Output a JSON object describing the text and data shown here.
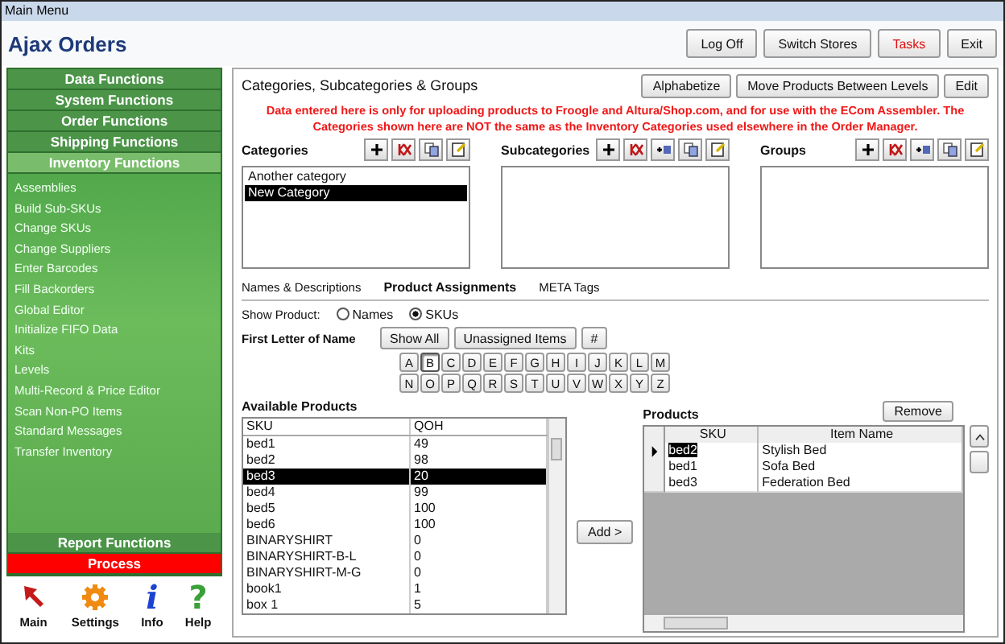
{
  "window": {
    "title": "Main Menu"
  },
  "app_title": "Ajax Orders",
  "header_buttons": [
    {
      "label": "Log Off",
      "kind": "normal"
    },
    {
      "label": "Switch Stores",
      "kind": "normal"
    },
    {
      "label": "Tasks",
      "kind": "alert"
    },
    {
      "label": "Exit",
      "kind": "normal"
    }
  ],
  "sidebar": {
    "sections": [
      {
        "label": "Data Functions",
        "selected": false
      },
      {
        "label": "System Functions",
        "selected": false
      },
      {
        "label": "Order Functions",
        "selected": false
      },
      {
        "label": "Shipping Functions",
        "selected": false
      },
      {
        "label": "Inventory Functions",
        "selected": true
      }
    ],
    "items": [
      "Assemblies",
      "Build Sub-SKUs",
      "Change SKUs",
      "Change Suppliers",
      "Enter Barcodes",
      "Fill Backorders",
      "Global Editor",
      "Initialize FIFO Data",
      "Kits",
      "Levels",
      "Multi-Record & Price Editor",
      "Scan Non-PO Items",
      "Standard Messages",
      "Transfer Inventory"
    ],
    "bottom_sections": [
      {
        "label": "Report Functions",
        "kind": "normal"
      },
      {
        "label": "Process",
        "kind": "alert"
      }
    ]
  },
  "launcher": [
    {
      "label": "Main",
      "kind": "cursor"
    },
    {
      "label": "Settings",
      "kind": "gear"
    },
    {
      "label": "Info",
      "kind": "info",
      "glyph": "i"
    },
    {
      "label": "Help",
      "kind": "help",
      "glyph": "?"
    }
  ],
  "panel": {
    "title": "Categories, Subcategories & Groups",
    "buttons": [
      "Alphabetize",
      "Move Products Between Levels",
      "Edit"
    ],
    "notice": "Data entered here is only for uploading products to Froogle and Altura/Shop.com, and for use with the ECom Assembler. The Categories shown here are NOT the same as the Inventory Categories used elsewhere in the Order Manager.",
    "lists": [
      {
        "label": "Categories",
        "tools": [
          {
            "kind": "add"
          },
          {
            "kind": "delete"
          },
          {
            "kind": "copy"
          },
          {
            "kind": "edit"
          }
        ],
        "items": [
          {
            "label": "Another category",
            "selected": false
          },
          {
            "label": "New Category",
            "selected": true
          }
        ]
      },
      {
        "label": "Subcategories",
        "tools": [
          {
            "kind": "add"
          },
          {
            "kind": "delete"
          },
          {
            "kind": "insert"
          },
          {
            "kind": "copy"
          },
          {
            "kind": "edit"
          }
        ]
      },
      {
        "label": "Groups",
        "tools": [
          {
            "kind": "add"
          },
          {
            "kind": "delete"
          },
          {
            "kind": "insert"
          },
          {
            "kind": "copy"
          },
          {
            "kind": "edit"
          }
        ]
      }
    ],
    "tabs": [
      {
        "label": "Names & Descriptions",
        "selected": false
      },
      {
        "label": "Product Assignments",
        "selected": true
      },
      {
        "label": "META Tags",
        "selected": false
      }
    ],
    "show_product": {
      "label": "Show Product:",
      "options": [
        {
          "label": "Names",
          "selected": false
        },
        {
          "label": "SKUs",
          "selected": true
        }
      ]
    },
    "letter_filter": {
      "label": "First Letter of Name",
      "buttons": [
        "Show All",
        "Unassigned Items",
        "#"
      ],
      "letters": [
        {
          "label": "A",
          "selected": false
        },
        {
          "label": "B",
          "selected": true
        },
        {
          "label": "C",
          "selected": false
        },
        {
          "label": "D",
          "selected": false
        },
        {
          "label": "E",
          "selected": false
        },
        {
          "label": "F",
          "selected": false
        },
        {
          "label": "G",
          "selected": false
        },
        {
          "label": "H",
          "selected": false
        },
        {
          "label": "I",
          "selected": false
        },
        {
          "label": "J",
          "selected": false
        },
        {
          "label": "K",
          "selected": false
        },
        {
          "label": "L",
          "selected": false
        },
        {
          "label": "M",
          "selected": false
        },
        {
          "label": "N",
          "selected": false
        },
        {
          "label": "O",
          "selected": false
        },
        {
          "label": "P",
          "selected": false
        },
        {
          "label": "Q",
          "selected": false
        },
        {
          "label": "R",
          "selected": false
        },
        {
          "label": "S",
          "selected": false
        },
        {
          "label": "T",
          "selected": false
        },
        {
          "label": "U",
          "selected": false
        },
        {
          "label": "V",
          "selected": false
        },
        {
          "label": "W",
          "selected": false
        },
        {
          "label": "X",
          "selected": false
        },
        {
          "label": "Y",
          "selected": false
        },
        {
          "label": "Z",
          "selected": false
        }
      ]
    },
    "available": {
      "title": "Available Products",
      "columns": [
        "SKU",
        "QOH"
      ],
      "rows": [
        {
          "cells": [
            "bed1",
            "49"
          ],
          "selected": false
        },
        {
          "cells": [
            "bed2",
            "98"
          ],
          "selected": false
        },
        {
          "cells": [
            "bed3",
            "20"
          ],
          "selected": true
        },
        {
          "cells": [
            "bed4",
            "99"
          ],
          "selected": false
        },
        {
          "cells": [
            "bed5",
            "100"
          ],
          "selected": false
        },
        {
          "cells": [
            "bed6",
            "100"
          ],
          "selected": false
        },
        {
          "cells": [
            "BINARYSHIRT",
            "0"
          ],
          "selected": false
        },
        {
          "cells": [
            "BINARYSHIRT-B-L",
            "0"
          ],
          "selected": false
        },
        {
          "cells": [
            "BINARYSHIRT-M-G",
            "0"
          ],
          "selected": false
        },
        {
          "cells": [
            "book1",
            "1"
          ],
          "selected": false
        },
        {
          "cells": [
            "box 1",
            "5"
          ],
          "selected": false
        }
      ]
    },
    "add_button": "Add >",
    "products": {
      "title": "Products",
      "remove_button": "Remove",
      "columns": [
        "SKU",
        "Item Name"
      ],
      "rows": [
        {
          "cells": [
            "bed2",
            "Stylish Bed"
          ],
          "current": true,
          "selected": true
        },
        {
          "cells": [
            "bed1",
            "Sofa Bed"
          ],
          "current": false,
          "selected": false
        },
        {
          "cells": [
            "bed3",
            "Federation Bed"
          ],
          "current": false,
          "selected": false
        }
      ]
    }
  }
}
